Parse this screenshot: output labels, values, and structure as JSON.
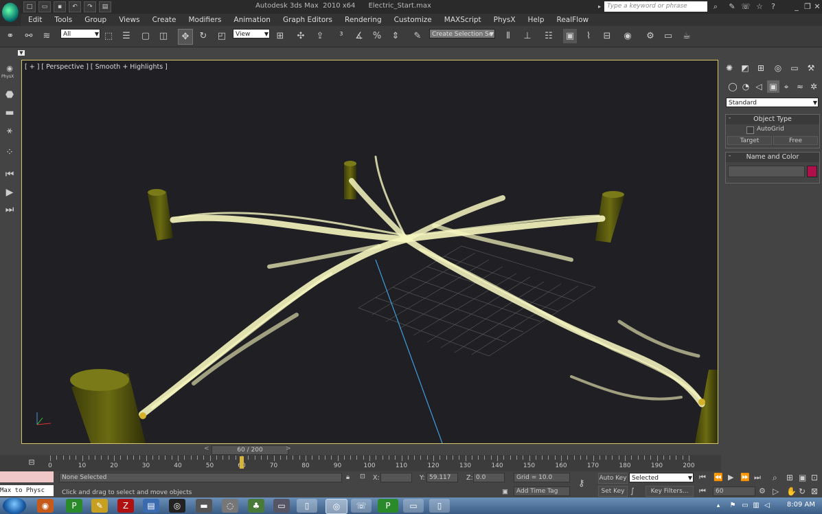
{
  "window": {
    "title": "Autodesk 3ds Max  2010 x64      Electric_Start.max",
    "search_placeholder": "Type a keyword or phrase"
  },
  "menu": [
    "Edit",
    "Tools",
    "Group",
    "Views",
    "Create",
    "Modifiers",
    "Animation",
    "Graph Editors",
    "Rendering",
    "Customize",
    "MAXScript",
    "PhysX",
    "Help",
    "RealFlow"
  ],
  "toolbar": {
    "selection_filter": "All",
    "ref_coord": "View",
    "named_selection_placeholder": "Create Selection Se"
  },
  "leftbar": {
    "physx_label": "PhysX"
  },
  "viewport": {
    "label": "[ + ] [ Perspective ] [ Smooth + Highlights ]",
    "accent_border": "#d7c76a",
    "background": "#1f1f24"
  },
  "command_panel": {
    "category_dropdown": "Standard",
    "object_type_header": "Object Type",
    "autogrid_label": "AutoGrid",
    "target_button": "Target",
    "free_button": "Free",
    "name_color_header": "Name and Color",
    "object_color": "#b0104a"
  },
  "timeline": {
    "slider_text": "60 / 200",
    "current_frame": 60,
    "tick_labels": [
      "0",
      "10",
      "20",
      "30",
      "40",
      "50",
      "60",
      "70",
      "80",
      "90",
      "100",
      "110",
      "120",
      "130",
      "140",
      "150",
      "160",
      "170",
      "180",
      "190",
      "200"
    ]
  },
  "status": {
    "maxscript_listener": "Max to Physc",
    "selection_status": "None Selected",
    "prompt": "Click and drag to select and move objects",
    "x_label": "X:",
    "x_value": "",
    "y_label": "Y:",
    "y_value": "59.117",
    "z_label": "Z:",
    "z_value": "0.0",
    "grid": "Grid = 10.0",
    "add_time_tag": "Add Time Tag",
    "auto_key": "Auto Key",
    "auto_key_mode": "Selected",
    "set_key": "Set Key",
    "key_filters": "Key Filters...",
    "frame_field": "60"
  },
  "taskbar": {
    "time": "8:09 AM"
  }
}
